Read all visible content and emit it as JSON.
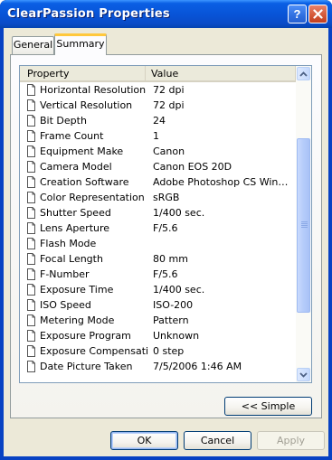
{
  "window": {
    "title": "ClearPassion Properties"
  },
  "tabs": [
    {
      "label": "General"
    },
    {
      "label": "Summary"
    }
  ],
  "list": {
    "columns": {
      "property": "Property",
      "value": "Value"
    },
    "rows": [
      {
        "property": "Horizontal Resolution",
        "value": "72 dpi"
      },
      {
        "property": "Vertical Resolution",
        "value": "72 dpi"
      },
      {
        "property": "Bit Depth",
        "value": "24"
      },
      {
        "property": "Frame Count",
        "value": "1"
      },
      {
        "property": "Equipment Make",
        "value": "Canon"
      },
      {
        "property": "Camera Model",
        "value": "Canon EOS 20D"
      },
      {
        "property": "Creation Software",
        "value": "Adobe Photoshop CS Windo..."
      },
      {
        "property": "Color Representation",
        "value": "sRGB"
      },
      {
        "property": "Shutter Speed",
        "value": "1/400 sec."
      },
      {
        "property": "Lens Aperture",
        "value": "F/5.6"
      },
      {
        "property": "Flash Mode",
        "value": ""
      },
      {
        "property": "Focal Length",
        "value": "80 mm"
      },
      {
        "property": "F-Number",
        "value": "F/5.6"
      },
      {
        "property": "Exposure Time",
        "value": "1/400 sec."
      },
      {
        "property": "ISO Speed",
        "value": "ISO-200"
      },
      {
        "property": "Metering Mode",
        "value": "Pattern"
      },
      {
        "property": "Exposure Program",
        "value": "Unknown"
      },
      {
        "property": "Exposure Compensation",
        "value": "0 step"
      },
      {
        "property": "Date Picture Taken",
        "value": "7/5/2006 1:46 AM"
      }
    ]
  },
  "buttons": {
    "simple": "<< Simple",
    "ok": "OK",
    "cancel": "Cancel",
    "apply": "Apply"
  },
  "icons": {
    "help": "help-icon",
    "close": "close-icon",
    "row": "document-icon"
  },
  "colors": {
    "titlebar": "#0853d6",
    "tab_highlight": "#ffc83c",
    "close_button": "#d55a3a"
  }
}
